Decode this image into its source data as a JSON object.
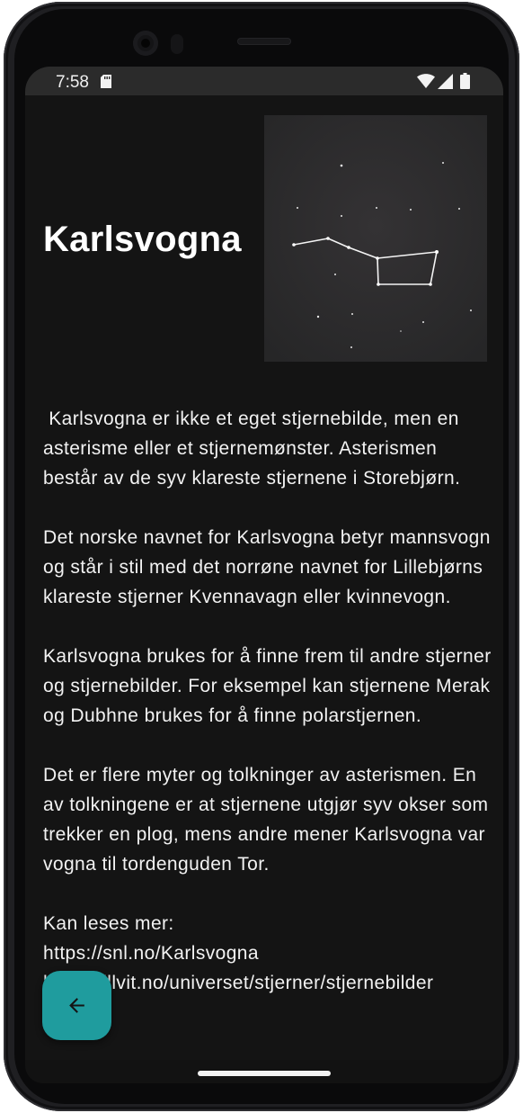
{
  "status_bar": {
    "time": "7:58",
    "icons": [
      "sd-card-icon",
      "wifi-icon",
      "cell-signal-icon",
      "battery-icon"
    ]
  },
  "article": {
    "title": "Karlsvogna",
    "image_name": "big-dipper-constellation-image",
    "body": " Karlsvogna er ikke et eget stjernebilde, men en asterisme eller et stjernemønster. Asterismen består av de syv klareste stjernene i Storebjørn.\n\nDet norske navnet for Karlsvogna betyr mannsvogn og står i stil med det norrøne navnet for Lillebjørns klareste stjerner Kvennavagn eller kvinnevogn.\n\nKarlsvogna brukes for å finne frem til andre stjerner og stjernebilder. For eksempel kan stjernene Merak og Dubhne brukes for å finne polarstjernen.\n\nDet er flere myter og tolkninger av asterismen. En av tolkningene er at stjernene utgjør syv okser som trekker en plog, mens andre mener Karlsvogna var vogna til tordenguden Tor.\n\nKan leses mer:\nhttps://snl.no/Karlsvogna\nhttps://illvit.no/universet/stjerner/stjernebilder"
  },
  "fab": {
    "icon": "arrow-back-icon"
  },
  "colors": {
    "background": "#141414",
    "status_bar": "#2b2b2b",
    "accent": "#1f9c9e",
    "text": "#f2f2f2"
  }
}
